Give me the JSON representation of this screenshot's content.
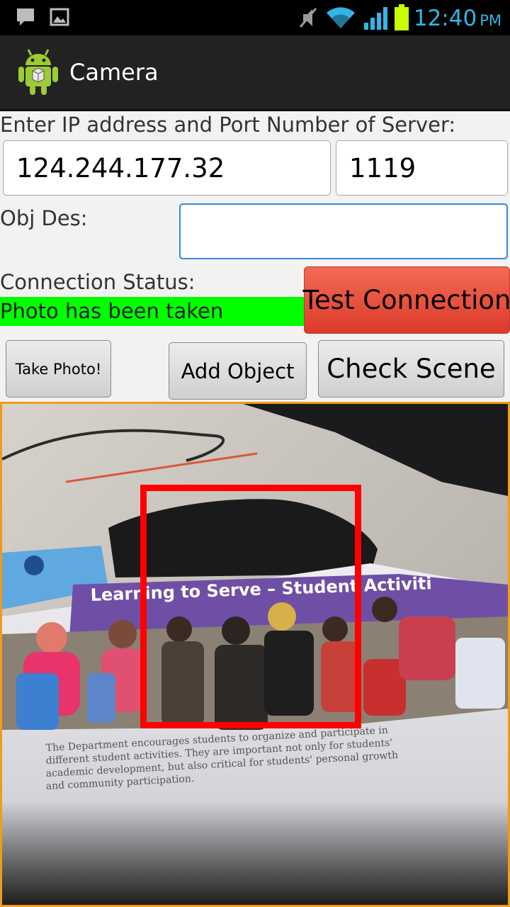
{
  "status_bar": {
    "time": "12:40",
    "ampm": "PM",
    "icons": [
      "chat-icon",
      "image-icon",
      "mute-icon",
      "wifi-icon",
      "signal-icon",
      "battery-icon"
    ]
  },
  "action_bar": {
    "title": "Camera",
    "icon": "android-app-icon"
  },
  "form": {
    "server_label": "Enter IP address and Port Number of Server:",
    "ip_value": "124.244.177.32",
    "port_value": "1119",
    "obj_des_label": "Obj Des:",
    "obj_des_value": "",
    "connection_status_label": "Connection Status:",
    "connection_status_value": "Photo has been taken",
    "status_color": "#00ff00"
  },
  "buttons": {
    "test_connection": "Test Connection",
    "take_photo": "Take Photo!",
    "add_object": "Add Object",
    "check_scene": "Check Scene"
  },
  "preview": {
    "brochure_title": "Learning to Serve – Student Activiti",
    "brochure_text_1": "The Department encourages students to organize and participate in",
    "brochure_text_2": "different student activities. They are important not only for students'",
    "brochure_text_3": "academic development, but also critical for  students' personal growth",
    "brochure_text_4": "and community participation.",
    "detection_color": "#ff0000",
    "border_color": "#f39a1a"
  }
}
